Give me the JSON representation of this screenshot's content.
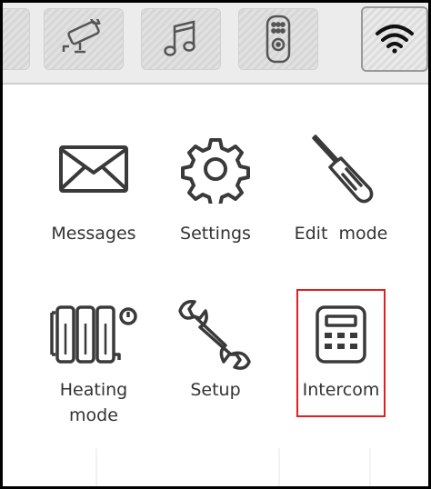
{
  "top_tabs": [
    {
      "icon": "camera-icon",
      "active": false
    },
    {
      "icon": "music-note-icon",
      "active": false
    },
    {
      "icon": "remote-control-icon",
      "active": false
    },
    {
      "icon": "wifi-icon",
      "active": true
    }
  ],
  "tiles": [
    {
      "icon": "envelope-icon",
      "label": "Messages"
    },
    {
      "icon": "gear-icon",
      "label": "Settings"
    },
    {
      "icon": "screwdriver-icon",
      "label": "Edit  mode"
    },
    {
      "icon": "radiator-icon",
      "label_line1": "Heating",
      "label_line2": "mode"
    },
    {
      "icon": "wrench-icon",
      "label": "Setup"
    },
    {
      "icon": "intercom-icon",
      "label": "Intercom",
      "highlighted": true
    }
  ],
  "colors": {
    "highlight": "#e0201c",
    "text": "#333333",
    "icon": "#3a3a3a"
  }
}
